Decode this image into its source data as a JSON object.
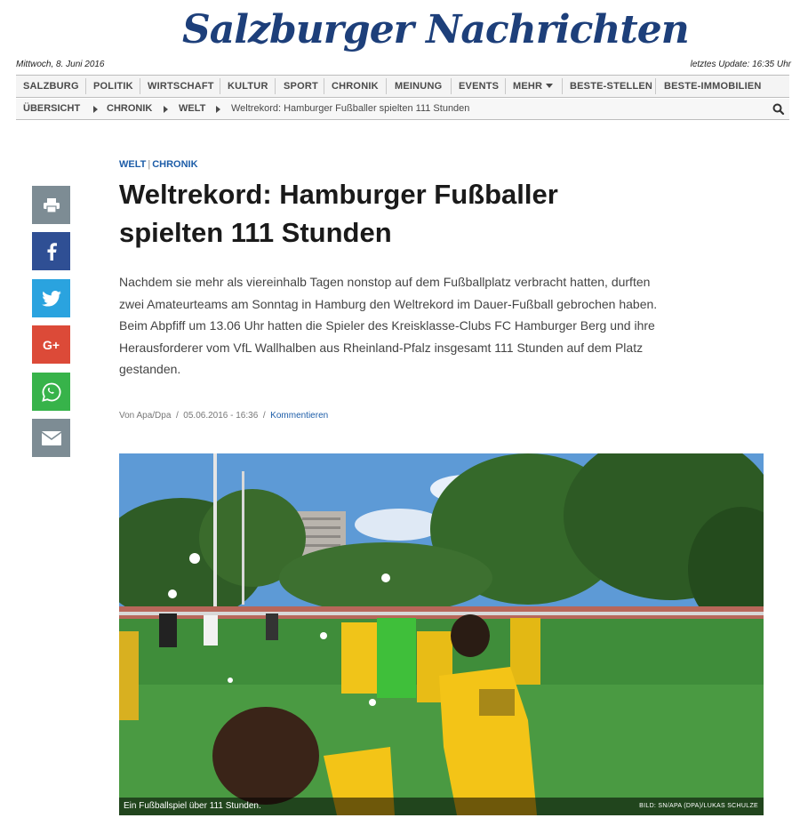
{
  "masthead": {
    "logo_text": "Salzburger Nachrichten",
    "brand_color": "#1d3f7a"
  },
  "dateline": {
    "date": "Mittwoch, 8. Juni 2016",
    "last_update": "letztes Update: 16:35 Uhr"
  },
  "nav": {
    "items": [
      "SALZBURG",
      "POLITIK",
      "WIRTSCHAFT",
      "KULTUR",
      "SPORT",
      "CHRONIK",
      "MEINUNG",
      "EVENTS",
      "MEHR",
      "BESTE-STELLEN",
      "BESTE-IMMOBILIEN"
    ]
  },
  "breadcrumb": {
    "items": [
      "ÜBERSICHT",
      "CHRONIK",
      "WELT"
    ],
    "current": "Weltrekord: Hamburger Fußballer spielten 111 Stunden"
  },
  "share": {
    "icons": [
      "print-icon",
      "facebook-icon",
      "twitter-icon",
      "google-plus-icon",
      "whatsapp-icon",
      "mail-icon"
    ],
    "google_plus_label": "G+",
    "colors": {
      "print": "#7d8c94",
      "facebook": "#2f4f94",
      "twitter": "#2aa3df",
      "google_plus": "#dc4a38",
      "whatsapp": "#37b34a",
      "mail": "#7d8c94"
    }
  },
  "article": {
    "kicker_primary": "WELT",
    "kicker_divider": "|",
    "kicker_secondary": "CHRONIK",
    "headline_line1": "Weltrekord: Hamburger Fußballer",
    "headline_line2": "spielten 111 Stunden",
    "lead": "Nachdem sie mehr als viereinhalb Tagen nonstop auf dem Fußballplatz verbracht hatten, durften zwei Amateurteams am Sonntag in Hamburg den Weltrekord im Dauer-Fußball gebrochen haben. Beim Abpfiff um 13.06 Uhr hatten die Spieler des Kreisklasse-Clubs FC Hamburger Berg und ihre Herausforderer vom VfL Wallhalben aus Rheinland-Pfalz insgesamt 111 Stunden auf dem Platz gestanden.",
    "author": "Von Apa/Dpa",
    "meta_sep1": "/",
    "date": "05.06.2016 - 16:36",
    "meta_sep2": "/",
    "comment_link": "Kommentieren",
    "accent_color": "#1d5da8"
  },
  "photo": {
    "caption": "Ein Fußballspiel über 111 Stunden.",
    "credit": "BILD: SN/APA (DPA)/LUKAS SCHULZE"
  }
}
